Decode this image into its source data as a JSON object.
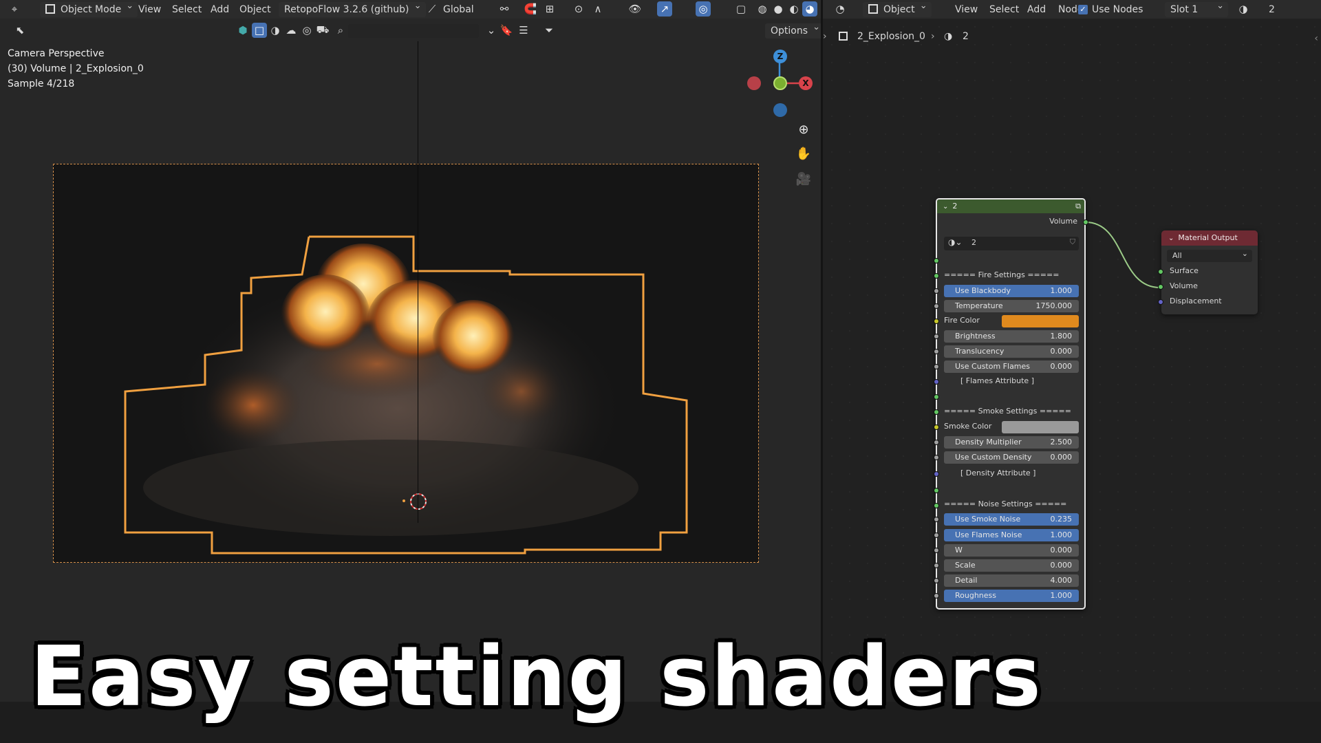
{
  "viewport_header": {
    "mode": "Object Mode",
    "menus": [
      "View",
      "Select",
      "Add",
      "Object"
    ],
    "addon": "RetopoFlow 3.2.6 (github)",
    "orientation": "Global",
    "options_label": "Options"
  },
  "viewport_overlay": {
    "line1": "Camera Perspective",
    "line2": "(30) Volume | 2_Explosion_0",
    "line3": "Sample 4/218"
  },
  "gizmo": {
    "z": "Z",
    "x": "X"
  },
  "node_header": {
    "type": "Object",
    "menus": [
      "View",
      "Select",
      "Add",
      "Node"
    ],
    "use_nodes": "Use Nodes",
    "slot": "Slot 1",
    "material": "2"
  },
  "breadcrumb": {
    "object": "2_Explosion_0",
    "material": "2"
  },
  "group_node": {
    "title": "2",
    "output": "Volume",
    "datablock": "2",
    "fire_section": "===== Fire Settings =====",
    "fire_rows": [
      {
        "label": "Use Blackbody",
        "value": "1.000",
        "active": true
      },
      {
        "label": "Temperature",
        "value": "1750.000",
        "active": true
      }
    ],
    "fire_color_label": "Fire Color",
    "fire_rows2": [
      {
        "label": "Brightness",
        "value": "1.800"
      },
      {
        "label": "Translucency",
        "value": "0.000"
      },
      {
        "label": "Use Custom Flames",
        "value": "0.000"
      }
    ],
    "flames_attr": "[ Flames Attribute ]",
    "smoke_section": "===== Smoke Settings =====",
    "smoke_color_label": "Smoke Color",
    "smoke_rows": [
      {
        "label": "Density Multiplier",
        "value": "2.500"
      },
      {
        "label": "Use Custom Density",
        "value": "0.000"
      }
    ],
    "density_attr": "[ Density Attribute ]",
    "noise_section": "===== Noise Settings =====",
    "noise_rows": [
      {
        "label": "Use Smoke Noise",
        "value": "0.235",
        "active": true
      },
      {
        "label": "Use Flames Noise",
        "value": "1.000",
        "active": true
      },
      {
        "label": "W",
        "value": "0.000"
      },
      {
        "label": "Scale",
        "value": "0.000"
      },
      {
        "label": "Detail",
        "value": "4.000"
      },
      {
        "label": "Roughness",
        "value": "1.000",
        "active": true
      }
    ]
  },
  "output_node": {
    "title": "Material Output",
    "target": "All",
    "sockets": [
      "Surface",
      "Volume",
      "Displacement"
    ]
  },
  "caption": "Easy setting shaders",
  "colors": {
    "fire_color": "#e08a1e",
    "smoke_color": "#9a9a9a",
    "accent": "#4772b3",
    "outline": "#f0a040"
  }
}
